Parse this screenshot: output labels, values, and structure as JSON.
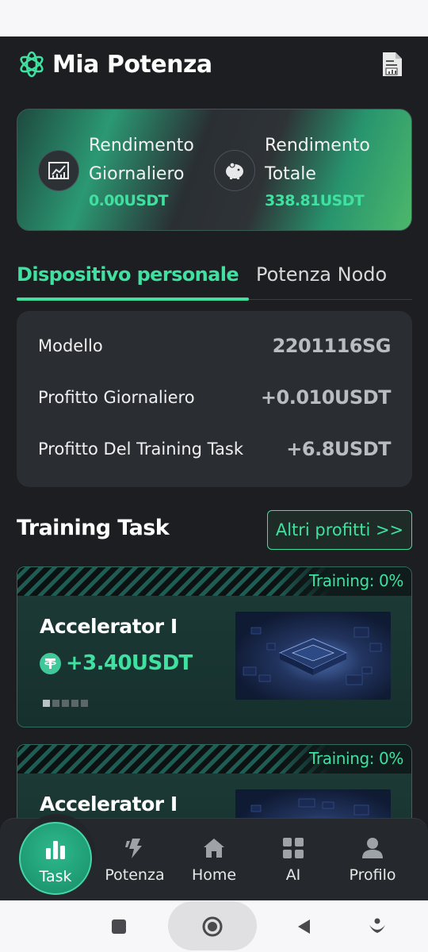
{
  "header": {
    "title": "Mia Potenza"
  },
  "summary": {
    "daily": {
      "label": "Rendimento Giornaliero",
      "value": "0.00USDT"
    },
    "total": {
      "label": "Rendimento Totale",
      "value": "338.81USDT"
    }
  },
  "tabs": [
    {
      "label": "Dispositivo personale",
      "active": true
    },
    {
      "label": "Potenza Nodo",
      "active": false
    }
  ],
  "device": {
    "rows": [
      {
        "label": "Modello",
        "value": "2201116SG"
      },
      {
        "label": "Profitto Giornaliero",
        "value": "+0.010USDT"
      },
      {
        "label": "Profitto Del Training Task",
        "value": "+6.8USDT"
      }
    ]
  },
  "training": {
    "title": "Training Task",
    "more_label": "Altri profitti >>",
    "tasks": [
      {
        "status": "Training: 0%",
        "name": "Accelerator I",
        "reward": "+3.40USDT",
        "level": 1,
        "level_max": 5
      },
      {
        "status": "Training: 0%",
        "name": "Accelerator I"
      }
    ]
  },
  "nav": {
    "items": [
      {
        "label": "Task",
        "icon": "bar-chart-icon",
        "active": true
      },
      {
        "label": "Potenza",
        "icon": "lightning-icon"
      },
      {
        "label": "Home",
        "icon": "home-icon"
      },
      {
        "label": "AI",
        "icon": "grid-icon"
      },
      {
        "label": "Profilo",
        "icon": "user-icon"
      }
    ]
  },
  "colors": {
    "accent": "#3fe0a0",
    "background": "#1c1e22",
    "card": "#2a2d32"
  }
}
